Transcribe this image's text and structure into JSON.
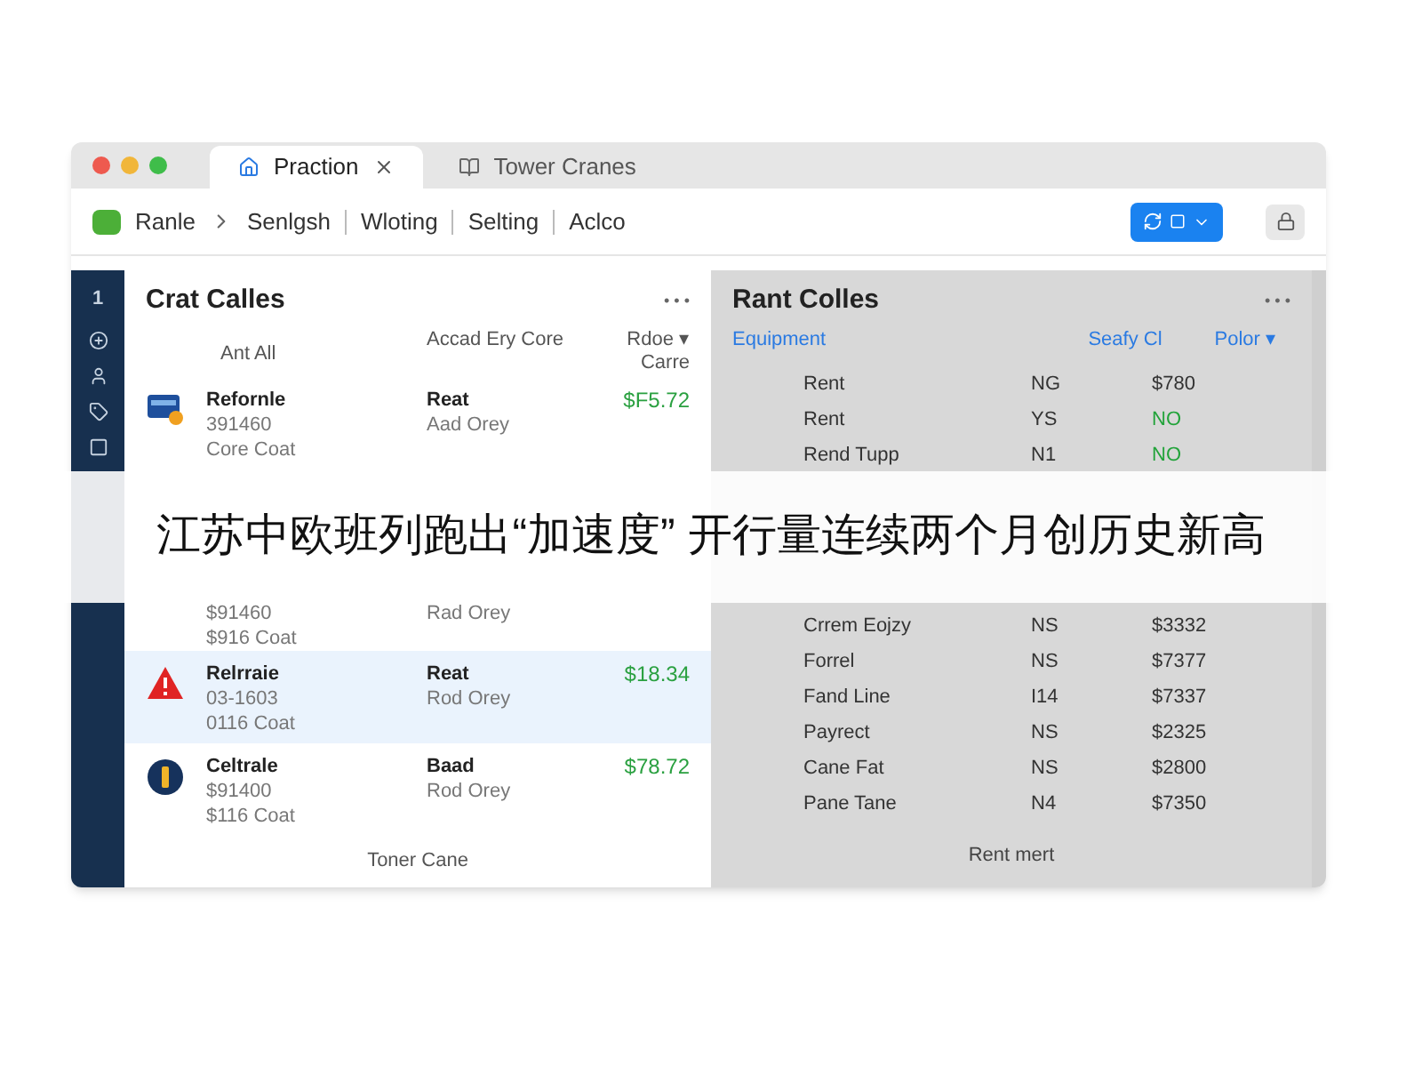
{
  "window": {
    "tabs": [
      {
        "label": "Praction",
        "selected": true,
        "closable": true
      },
      {
        "label": "Tower Cranes",
        "selected": false,
        "closable": false
      }
    ]
  },
  "toolbar": {
    "breadcrumb": [
      {
        "label": "Ranle",
        "kind": "home"
      },
      {
        "label": "Senlgsh",
        "kind": "plain"
      },
      {
        "label": "Wloting",
        "kind": "plain"
      },
      {
        "label": "Selting",
        "kind": "plain"
      },
      {
        "label": "Aclco",
        "kind": "plain"
      }
    ]
  },
  "sidebar": {
    "number": "1"
  },
  "left_panel": {
    "title": "Crat Calles",
    "more": "• • •",
    "columns": [
      "Ant All",
      "Accad Ery Core",
      "Rdoe ▾ Carre"
    ],
    "rows": [
      {
        "kind": "card",
        "name": "Refornle",
        "line_1": "391460",
        "line_2": "Core Coat",
        "status": "Reat",
        "note": "Aad Orey",
        "price": "$F5.72",
        "selected": false
      },
      {
        "line_1": "$91460",
        "line_2": "$916 Coat",
        "note": "Rad Orey",
        "selected": false
      },
      {
        "kind": "warning",
        "name": "Relrraie",
        "line_1": "03-1603",
        "line_2": "0116 Coat",
        "status": "Reat",
        "note": "Rod Orey",
        "price": "$18.34",
        "selected": true
      },
      {
        "kind": "info",
        "name": "Celtrale",
        "line_1": "$91400",
        "line_2": "$116 Coat",
        "status": "Baad",
        "note": "Rod Orey",
        "price": "$78.72",
        "selected": false
      }
    ],
    "footer": "Toner Cane"
  },
  "right_panel": {
    "title": "Rant Colles",
    "more": "• • •",
    "columns": [
      "Equipment",
      "Seafy Cl",
      "Polor ▾"
    ],
    "rows": [
      {
        "name": "Rent",
        "code": "NG",
        "value": "$780",
        "color": "#333333"
      },
      {
        "name": "Rent",
        "code": "YS",
        "value": "NO",
        "color": "#22a33a"
      },
      {
        "name": "Rend Tupp",
        "code": "N1",
        "value": "NO",
        "color": "#22a33a"
      },
      {
        "name": "Crrem Eojzy",
        "code": "NS",
        "value": "$3332",
        "color": "#333333"
      },
      {
        "name": "Forrel",
        "code": "NS",
        "value": "$7377",
        "color": "#333333"
      },
      {
        "name": "Fand Line",
        "code": "I14",
        "value": "$7337",
        "color": "#333333"
      },
      {
        "name": "Payrect",
        "code": "NS",
        "value": "$2325",
        "color": "#333333"
      },
      {
        "name": "Cane Fat",
        "code": "NS",
        "value": "$2800",
        "color": "#333333"
      },
      {
        "name": "Pane Tane",
        "code": "N4",
        "value": "$7350",
        "color": "#333333"
      }
    ],
    "footer": "Rent mert"
  },
  "banner": {
    "headline": "江苏中欧班列跑出“加速度” 开行量连续两个月创历史新高"
  }
}
